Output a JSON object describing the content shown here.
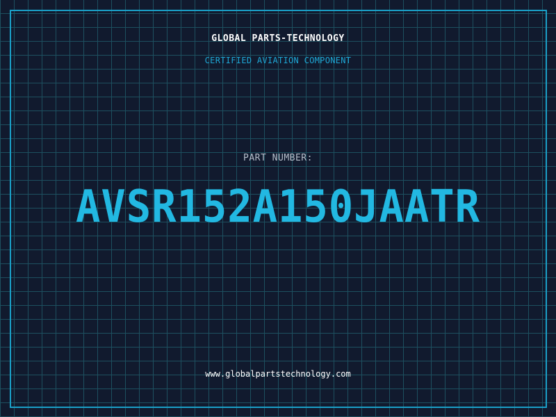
{
  "brand": {
    "name": "GLOBAL PARTS-TECHNOLOGY",
    "tagline": "CERTIFIED AVIATION COMPONENT"
  },
  "part": {
    "label": "PART NUMBER:",
    "number": "AVSR152A150JAATR"
  },
  "footer": {
    "website": "www.globalpartstechnology.com"
  },
  "colors": {
    "background": "#111a2e",
    "grid": "#1d5060",
    "frame": "#1aa0c8",
    "accent": "#22b8e2"
  }
}
